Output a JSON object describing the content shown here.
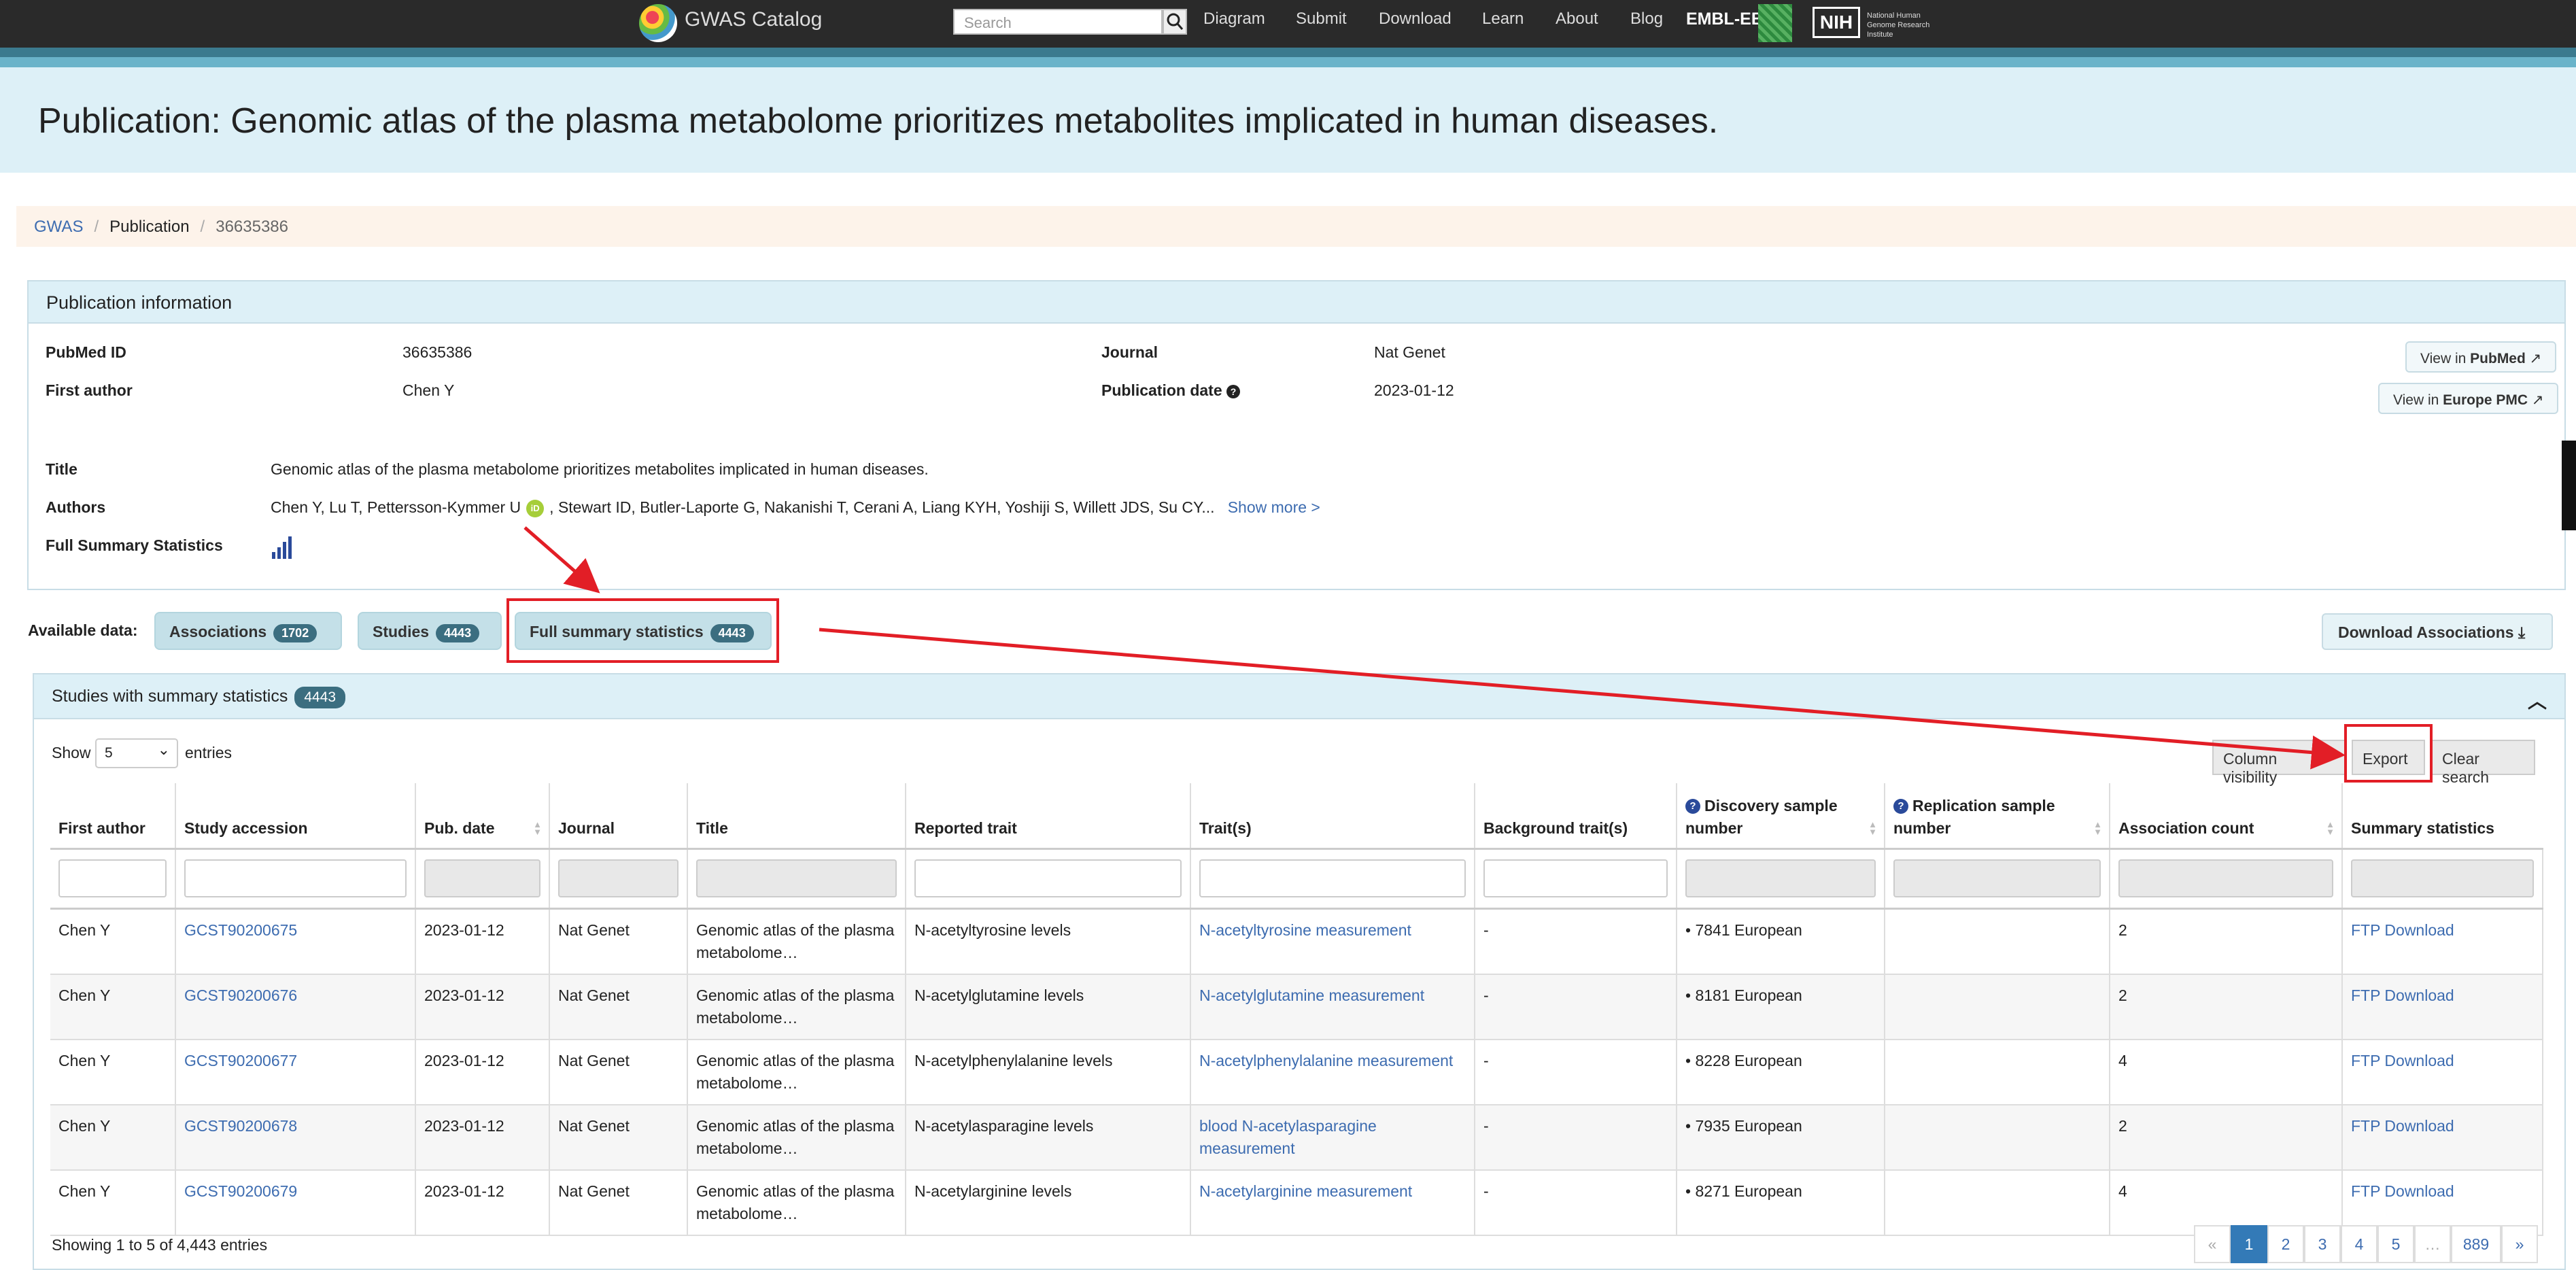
{
  "nav": {
    "brand": "GWAS Catalog",
    "search_placeholder": "Search",
    "links": [
      "Diagram",
      "Submit",
      "Download",
      "Learn",
      "About",
      "Blog"
    ],
    "ebi": "EMBL-EBI",
    "nih_abbr": "NIH",
    "nih_name": "National Human Genome Research Institute"
  },
  "page_title": "Publication:  Genomic atlas of the plasma metabolome prioritizes metabolites implicated in human diseases.",
  "breadcrumb": [
    "GWAS",
    "Publication",
    "36635386"
  ],
  "pubinfo": {
    "header": "Publication information",
    "pmid_label": "PubMed ID",
    "pmid": "36635386",
    "first_author_label": "First author",
    "first_author": "Chen Y",
    "journal_label": "Journal",
    "journal": "Nat Genet",
    "pubdate_label": "Publication date",
    "pubdate": "2023-01-12",
    "title_label": "Title",
    "title": "Genomic atlas of the plasma metabolome prioritizes metabolites implicated in human diseases.",
    "authors_label": "Authors",
    "authors_a": "Chen Y, Lu T, Pettersson-Kymmer U",
    "authors_b": ", Stewart ID, Butler-Laporte G, Nakanishi T, Cerani A, Liang KYH, Yoshiji S, Willett JDS, Su CY...",
    "show_more": "Show more >",
    "fss_label": "Full Summary Statistics",
    "view_pubmed_pre": "View in ",
    "view_pubmed": "PubMed",
    "view_epmc_pre": "View in ",
    "view_epmc": "Europe PMC"
  },
  "available": {
    "label": "Available data:",
    "assoc": "Associations",
    "assoc_count": "1702",
    "studies": "Studies",
    "studies_count": "4443",
    "fss": "Full summary statistics",
    "fss_count": "4443",
    "download": "Download Associations"
  },
  "studies_panel": {
    "header": "Studies with summary statistics",
    "count": "4443",
    "show": "Show",
    "entries_value": "5",
    "entries": "entries",
    "col_vis": "Column visibility",
    "export": "Export",
    "clear": "Clear search",
    "columns": [
      "First author",
      "Study accession",
      "Pub. date",
      "Journal",
      "Title",
      "Reported trait",
      "Trait(s)",
      "Background trait(s)",
      "Discovery sample number",
      "Replication sample number",
      "Association count",
      "Summary statistics"
    ],
    "rows": [
      {
        "author": "Chen Y",
        "acc": "GCST90200675",
        "date": "2023-01-12",
        "journal": "Nat Genet",
        "title": "Genomic atlas of the plasma metabolome…",
        "reported": "N-acetyltyrosine levels",
        "trait": "N-acetyltyrosine measurement",
        "bg": "-",
        "disc": "• 7841 European",
        "rep": "",
        "count": "2",
        "ss": "FTP Download"
      },
      {
        "author": "Chen Y",
        "acc": "GCST90200676",
        "date": "2023-01-12",
        "journal": "Nat Genet",
        "title": "Genomic atlas of the plasma metabolome…",
        "reported": "N-acetylglutamine levels",
        "trait": "N-acetylglutamine measurement",
        "bg": "-",
        "disc": "• 8181 European",
        "rep": "",
        "count": "2",
        "ss": "FTP Download"
      },
      {
        "author": "Chen Y",
        "acc": "GCST90200677",
        "date": "2023-01-12",
        "journal": "Nat Genet",
        "title": "Genomic atlas of the plasma metabolome…",
        "reported": "N-acetylphenylalanine levels",
        "trait": "N-acetylphenylalanine measurement",
        "bg": "-",
        "disc": "• 8228 European",
        "rep": "",
        "count": "4",
        "ss": "FTP Download"
      },
      {
        "author": "Chen Y",
        "acc": "GCST90200678",
        "date": "2023-01-12",
        "journal": "Nat Genet",
        "title": "Genomic atlas of the plasma metabolome…",
        "reported": "N-acetylasparagine levels",
        "trait": "blood N-acetylasparagine measurement",
        "bg": "-",
        "disc": "• 7935 European",
        "rep": "",
        "count": "2",
        "ss": "FTP Download"
      },
      {
        "author": "Chen Y",
        "acc": "GCST90200679",
        "date": "2023-01-12",
        "journal": "Nat Genet",
        "title": "Genomic atlas of the plasma metabolome…",
        "reported": "N-acetylarginine levels",
        "trait": "N-acetylarginine measurement",
        "bg": "-",
        "disc": "• 8271 European",
        "rep": "",
        "count": "4",
        "ss": "FTP Download"
      }
    ],
    "footer": "Showing 1 to 5 of 4,443 entries",
    "pages": [
      "«",
      "1",
      "2",
      "3",
      "4",
      "5",
      "…",
      "889",
      "»"
    ]
  }
}
